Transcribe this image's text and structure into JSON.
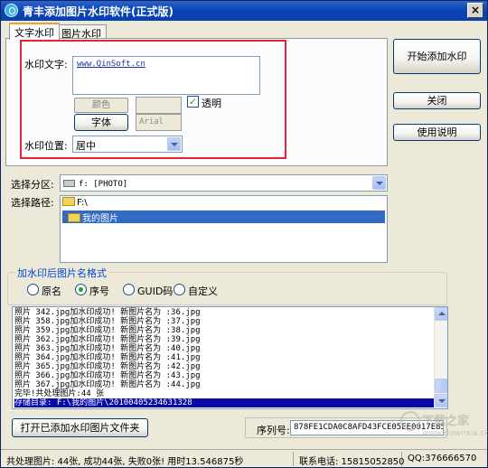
{
  "window": {
    "title": "青丰添加图片水印软件(正式版)",
    "close_symbol": "×"
  },
  "tabs": [
    {
      "label": "文字水印",
      "active": true
    },
    {
      "label": "图片水印",
      "active": false
    }
  ],
  "text_watermark": {
    "text_label": "水印文字:",
    "text_value": "www.QinSoft.cn",
    "color_label": "颜色",
    "font_label": "字体",
    "font_value": "Arial",
    "transparent_label": "透明",
    "transparent_checked": true,
    "position_label": "水印位置:",
    "position_value": "居中"
  },
  "side_buttons": {
    "start": "开始添加水印",
    "close": "关闭",
    "help": "使用说明"
  },
  "drive": {
    "label": "选择分区:",
    "value": "f: [PHOTO]"
  },
  "path": {
    "label": "选择路径:",
    "items": [
      {
        "label": "F:\\",
        "selected": false
      },
      {
        "label": "我的图片",
        "selected": true
      }
    ]
  },
  "name_format": {
    "title": "加水印后图片名格式",
    "options": [
      {
        "label": "原名",
        "checked": false
      },
      {
        "label": "序号",
        "checked": true
      },
      {
        "label": "GUID码",
        "checked": false
      },
      {
        "label": "自定义",
        "checked": false
      }
    ]
  },
  "log": {
    "lines": [
      "照片 342.jpg加水印成功! 新图片名为 :36.jpg",
      "照片 358.jpg加水印成功! 新图片名为 :37.jpg",
      "照片 359.jpg加水印成功! 新图片名为 :38.jpg",
      "照片 362.jpg加水印成功! 新图片名为 :39.jpg",
      "照片 363.jpg加水印成功! 新图片名为 :40.jpg",
      "照片 364.jpg加水印成功! 新图片名为 :41.jpg",
      "照片 365.jpg加水印成功! 新图片名为 :42.jpg",
      "照片 366.jpg加水印成功! 新图片名为 :43.jpg",
      "照片 367.jpg加水印成功! 新图片名为 :44.jpg",
      "完毕!共处理图片:44 张",
      "存储目录: F:\\我的图片\\20100405234631328"
    ],
    "highlighted_index": 10
  },
  "open_folder_button": "打开已添加水印图片文件夹",
  "serial": {
    "label": "序列号:",
    "value": "878FE1CDA0C8AFD43FCE05EE0017E85"
  },
  "status": {
    "summary": "共处理图片: 44张,  成功44张, 失败0张!  用时13.546875秒",
    "phone": "联系电话: 15815052850",
    "qq": "QQ:376666570"
  },
  "watermark_logo": {
    "title": "下载之家",
    "url": "www.downxia.com"
  },
  "colors": {
    "title_bar": "#0b46b8",
    "highlight_box": "#e8242c",
    "selection": "#316ac5",
    "log_highlight": "#0a0aa8"
  }
}
